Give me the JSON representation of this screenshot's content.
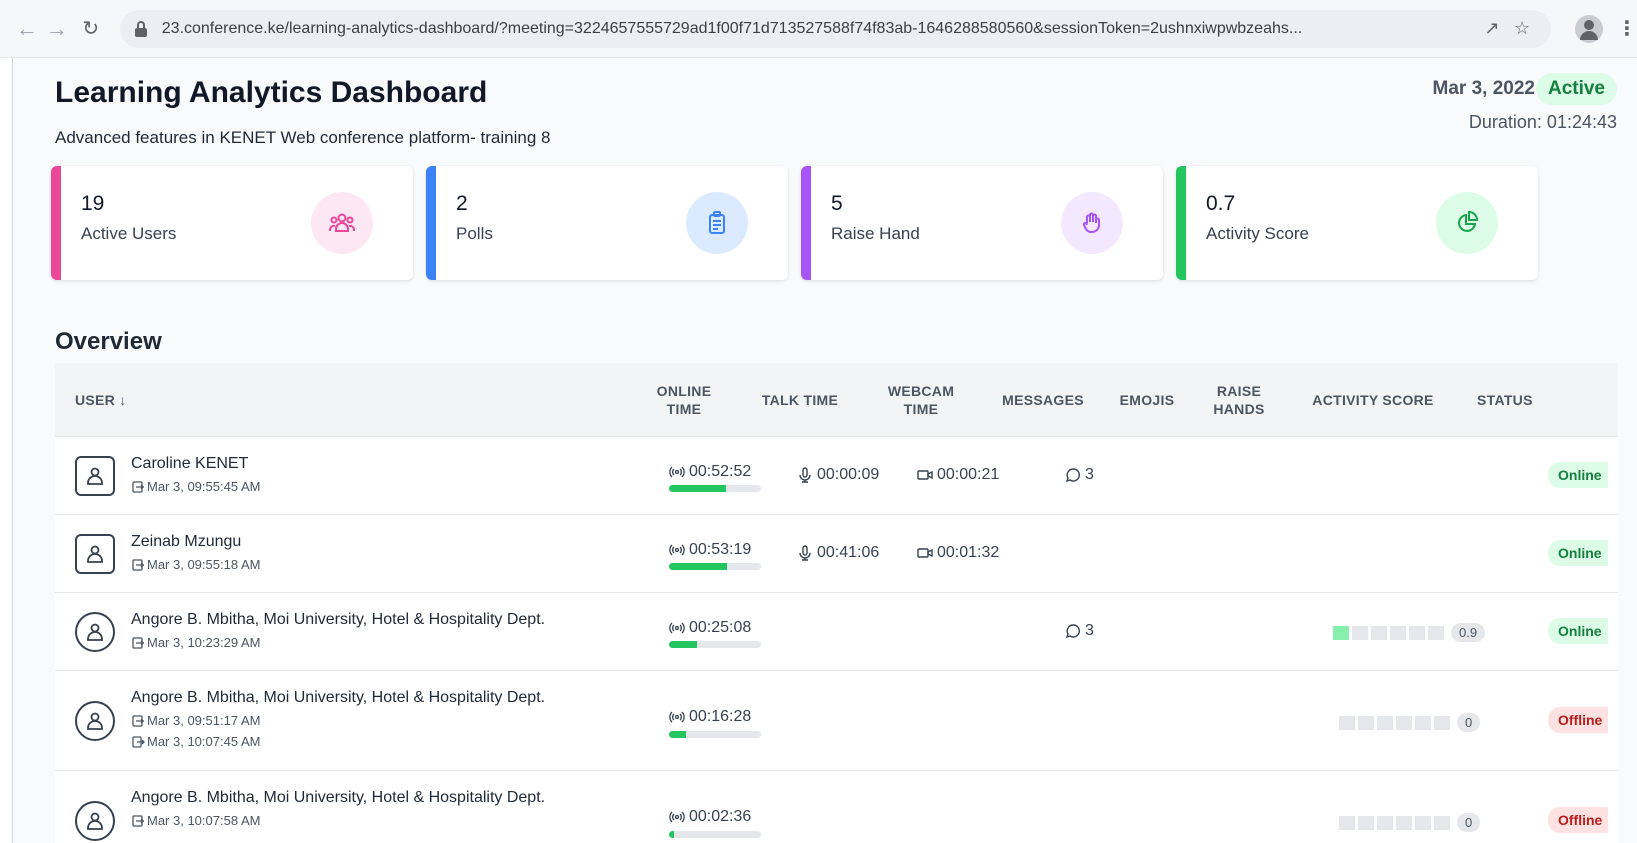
{
  "browser": {
    "url": "23.conference.ke/learning-analytics-dashboard/?meeting=3224657555729ad1f00f71d713527588f74f83ab-1646288580560&sessionToken=2ushnxiwpwbzeahs..."
  },
  "header": {
    "title": "Learning Analytics Dashboard",
    "subtitle": "Advanced features in KENET Web conference platform- training 8",
    "date": "Mar 3, 2022",
    "status": "Active",
    "duration": "Duration: 01:24:43"
  },
  "cards": [
    {
      "value": "19",
      "label": "Active Users",
      "icon": "users-icon",
      "accent": "#ec4899"
    },
    {
      "value": "2",
      "label": "Polls",
      "icon": "clipboard-icon",
      "accent": "#3b82f6"
    },
    {
      "value": "5",
      "label": "Raise Hand",
      "icon": "hand-icon",
      "accent": "#a855f7"
    },
    {
      "value": "0.7",
      "label": "Activity Score",
      "icon": "pie-chart-icon",
      "accent": "#22c55e"
    }
  ],
  "overview": {
    "heading": "Overview",
    "columns": {
      "user": "USER ↓",
      "online_time": "ONLINE TIME",
      "talk_time": "TALK TIME",
      "webcam_time": "WEBCAM TIME",
      "messages": "MESSAGES",
      "emojis": "EMOJIS",
      "raise_hands": "RAISE HANDS",
      "activity_score": "ACTIVITY SCORE",
      "status": "STATUS"
    },
    "rows": [
      {
        "name": "Caroline KENET",
        "avatar": "square",
        "join": "Mar 3, 09:55:45 AM",
        "online": "00:52:52",
        "online_pct": 0.62,
        "talk": "00:00:09",
        "webcam": "00:00:21",
        "messages": "3",
        "status": "Online"
      },
      {
        "name": "Zeinab Mzungu",
        "avatar": "square",
        "join": "Mar 3, 09:55:18 AM",
        "online": "00:53:19",
        "online_pct": 0.63,
        "talk": "00:41:06",
        "webcam": "00:01:32",
        "status": "Online"
      },
      {
        "name": "Angore B. Mbitha, Moi University, Hotel & Hospitality Dept.",
        "avatar": "round",
        "join": "Mar 3, 10:23:29 AM",
        "online": "00:25:08",
        "online_pct": 0.3,
        "messages": "3",
        "score": "0.9",
        "score_level": 1,
        "status": "Online"
      },
      {
        "name": "Angore B. Mbitha, Moi University, Hotel & Hospitality Dept.",
        "avatar": "round",
        "join": "Mar 3, 09:51:17 AM",
        "leave": "Mar 3, 10:07:45 AM",
        "online": "00:16:28",
        "online_pct": 0.19,
        "score": "0",
        "score_level": 0,
        "status": "Offline"
      },
      {
        "name": "Angore B. Mbitha, Moi University, Hotel & Hospitality Dept.",
        "avatar": "round",
        "join": "Mar 3, 10:07:58 AM",
        "online": "00:02:36",
        "online_pct": 0.05,
        "score": "0",
        "score_level": 0,
        "status": "Offline"
      }
    ]
  }
}
